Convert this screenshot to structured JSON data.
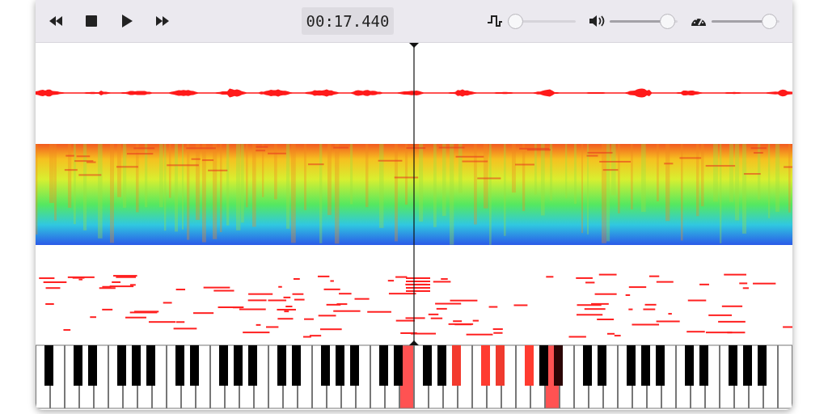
{
  "toolbar": {
    "buttons": [
      {
        "kind": "rewind"
      },
      {
        "kind": "stop"
      },
      {
        "kind": "play"
      },
      {
        "kind": "forward"
      }
    ],
    "time": "00:17.440",
    "sliders": [
      {
        "kind": "step",
        "level": 0
      },
      {
        "kind": "volume",
        "level": 0.95
      },
      {
        "kind": "speed",
        "level": 0.95
      }
    ]
  },
  "keys": [
    {
      "kind": "white",
      "pressed": false
    },
    {
      "kind": "black",
      "pressed": false
    },
    {
      "kind": "white",
      "pressed": false
    },
    {
      "kind": "white",
      "pressed": false
    },
    {
      "kind": "black",
      "pressed": false
    },
    {
      "kind": "white",
      "pressed": false
    },
    {
      "kind": "black",
      "pressed": false
    },
    {
      "kind": "white",
      "pressed": false
    },
    {
      "kind": "white",
      "pressed": false
    },
    {
      "kind": "black",
      "pressed": false
    },
    {
      "kind": "white",
      "pressed": false
    },
    {
      "kind": "black",
      "pressed": false
    },
    {
      "kind": "white",
      "pressed": false
    },
    {
      "kind": "black",
      "pressed": false
    },
    {
      "kind": "white",
      "pressed": false
    },
    {
      "kind": "white",
      "pressed": false
    },
    {
      "kind": "black",
      "pressed": false
    },
    {
      "kind": "white",
      "pressed": false
    },
    {
      "kind": "black",
      "pressed": false
    },
    {
      "kind": "white",
      "pressed": false
    },
    {
      "kind": "white",
      "pressed": false
    },
    {
      "kind": "black",
      "pressed": false
    },
    {
      "kind": "white",
      "pressed": false
    },
    {
      "kind": "black",
      "pressed": false
    },
    {
      "kind": "white",
      "pressed": false
    },
    {
      "kind": "black",
      "pressed": false
    },
    {
      "kind": "white",
      "pressed": false
    },
    {
      "kind": "white",
      "pressed": false
    },
    {
      "kind": "black",
      "pressed": false
    },
    {
      "kind": "white",
      "pressed": false
    },
    {
      "kind": "black",
      "pressed": false
    },
    {
      "kind": "white",
      "pressed": false
    },
    {
      "kind": "white",
      "pressed": false
    },
    {
      "kind": "black",
      "pressed": false
    },
    {
      "kind": "white",
      "pressed": false
    },
    {
      "kind": "black",
      "pressed": false
    },
    {
      "kind": "white",
      "pressed": false
    },
    {
      "kind": "black",
      "pressed": false
    },
    {
      "kind": "white",
      "pressed": false
    },
    {
      "kind": "white",
      "pressed": false
    },
    {
      "kind": "black",
      "pressed": false
    },
    {
      "kind": "white",
      "pressed": false
    },
    {
      "kind": "black",
      "pressed": false
    },
    {
      "kind": "white",
      "pressed": true,
      "color": "#ff5252"
    },
    {
      "kind": "white",
      "pressed": false
    },
    {
      "kind": "black",
      "pressed": false
    },
    {
      "kind": "white",
      "pressed": false
    },
    {
      "kind": "black",
      "pressed": false
    },
    {
      "kind": "white",
      "pressed": false
    },
    {
      "kind": "black",
      "pressed": true,
      "color": "#f33a2e"
    },
    {
      "kind": "white",
      "pressed": false
    },
    {
      "kind": "white",
      "pressed": false
    },
    {
      "kind": "black",
      "pressed": true,
      "color": "#ff3b30"
    },
    {
      "kind": "white",
      "pressed": false
    },
    {
      "kind": "black",
      "pressed": true,
      "color": "#f03a2e"
    },
    {
      "kind": "white",
      "pressed": false
    },
    {
      "kind": "white",
      "pressed": false
    },
    {
      "kind": "black",
      "pressed": true,
      "color": "#ff3b30"
    },
    {
      "kind": "white",
      "pressed": false
    },
    {
      "kind": "black",
      "pressed": false
    },
    {
      "kind": "white",
      "pressed": true,
      "color": "#ff5252"
    },
    {
      "kind": "black",
      "pressed": true,
      "color": "#2b0505"
    },
    {
      "kind": "white",
      "pressed": false
    },
    {
      "kind": "white",
      "pressed": false
    },
    {
      "kind": "black",
      "pressed": false
    },
    {
      "kind": "white",
      "pressed": false
    },
    {
      "kind": "black",
      "pressed": false
    },
    {
      "kind": "white",
      "pressed": false
    },
    {
      "kind": "white",
      "pressed": false
    },
    {
      "kind": "black",
      "pressed": false
    },
    {
      "kind": "white",
      "pressed": false
    },
    {
      "kind": "black",
      "pressed": false
    },
    {
      "kind": "white",
      "pressed": false
    },
    {
      "kind": "black",
      "pressed": false
    },
    {
      "kind": "white",
      "pressed": false
    },
    {
      "kind": "white",
      "pressed": false
    },
    {
      "kind": "black",
      "pressed": false
    },
    {
      "kind": "white",
      "pressed": false
    },
    {
      "kind": "black",
      "pressed": false
    },
    {
      "kind": "white",
      "pressed": false
    },
    {
      "kind": "white",
      "pressed": false
    },
    {
      "kind": "black",
      "pressed": false
    },
    {
      "kind": "white",
      "pressed": false
    },
    {
      "kind": "black",
      "pressed": false
    },
    {
      "kind": "white",
      "pressed": false
    },
    {
      "kind": "black",
      "pressed": false
    },
    {
      "kind": "white",
      "pressed": false
    },
    {
      "kind": "white",
      "pressed": false
    }
  ]
}
